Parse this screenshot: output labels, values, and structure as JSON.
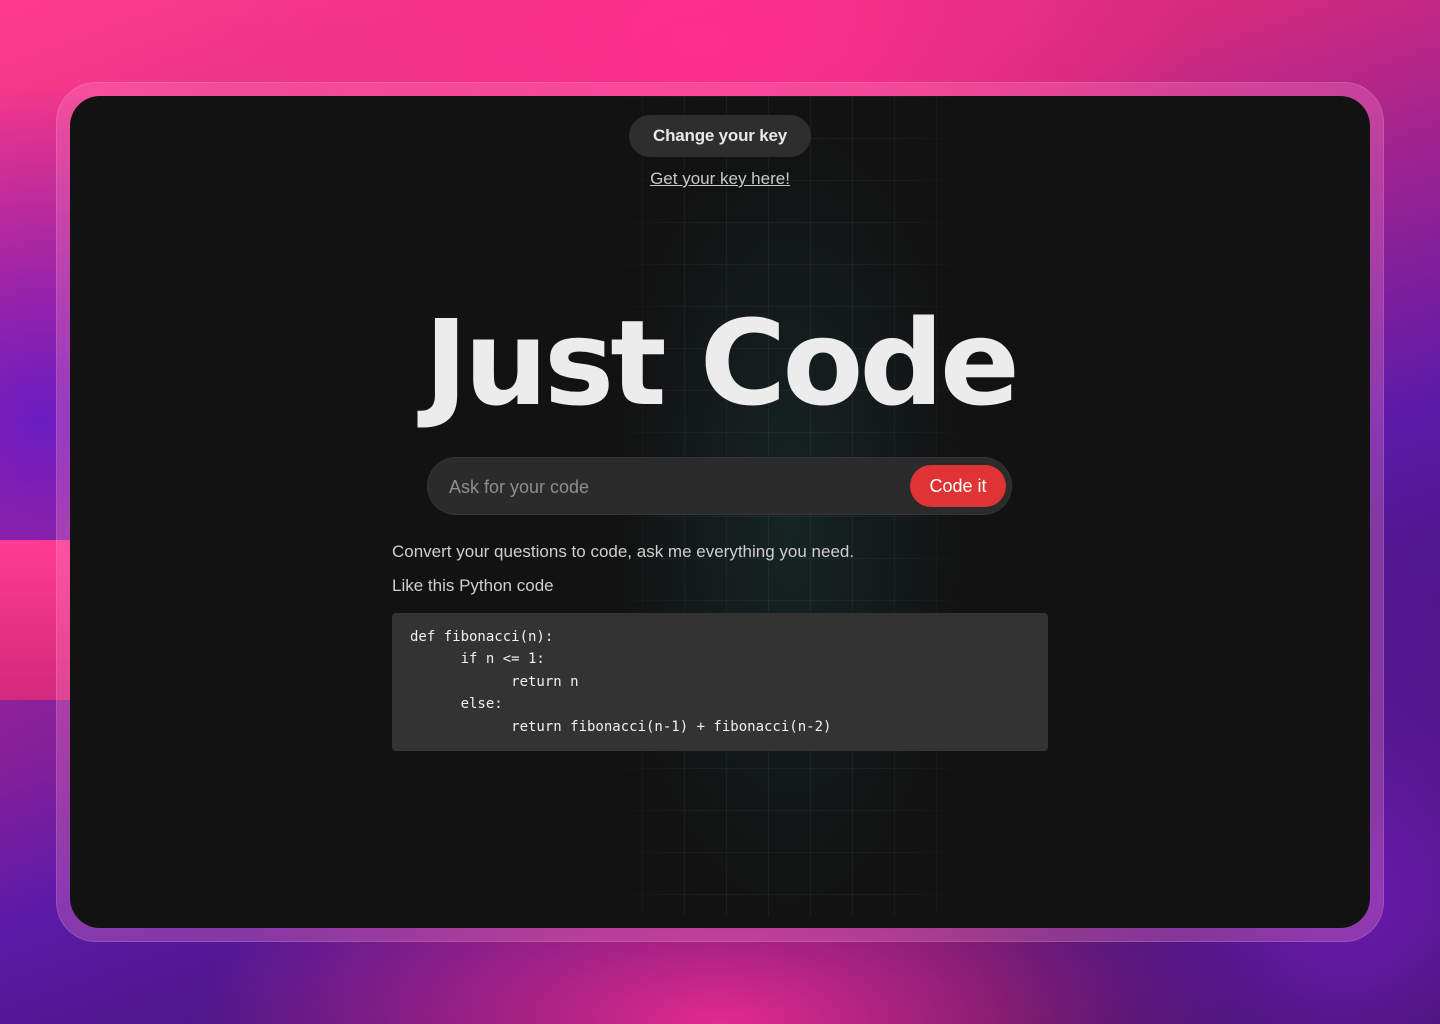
{
  "header": {
    "change_key_label": "Change your key",
    "get_key_link": "Get your key here!"
  },
  "hero": {
    "title": "Just Code"
  },
  "search": {
    "placeholder": "Ask for your code",
    "value": "",
    "submit_label": "Code it"
  },
  "content": {
    "description": "Convert your questions to code, ask me everything you need.",
    "example_intro": "Like this Python code",
    "example_code": "def fibonacci(n):\n      if n <= 1:\n            return n\n      else:\n            return fibonacci(n-1) + fibonacci(n-2)"
  },
  "colors": {
    "accent_button": "#e03333",
    "window_background": "#121212",
    "pink_gradient": "#ff3b8e",
    "purple_gradient": "#6a1ab0"
  }
}
